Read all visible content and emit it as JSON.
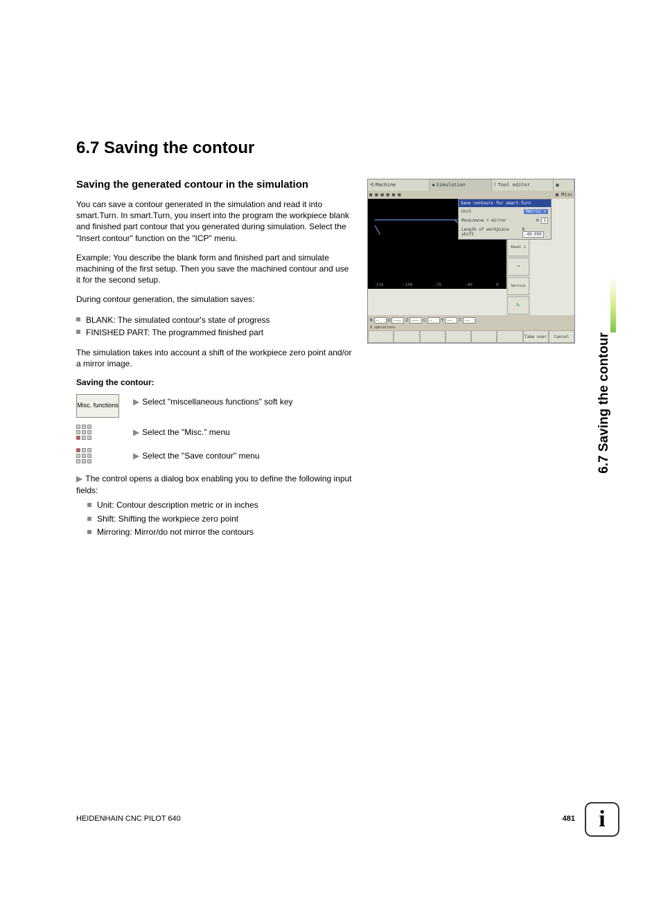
{
  "header": {
    "title": "6.7   Saving the contour",
    "subtitle": "Saving the generated contour in the simulation"
  },
  "paragraphs": {
    "p1": "You can save a contour generated in the simulation and read it into smart.Turn. In smart.Turn, you insert into the program the workpiece blank and finished part contour that you generated during simulation. Select the \"Insert contour\" function on the \"ICP\" menu.",
    "p2": "Example: You describe the blank form and finished part and simulate machining of the first setup. Then you save the machined contour and use it for the second setup.",
    "p3": "During contour generation, the simulation saves:",
    "p4": "The simulation takes into account a shift of the workpiece zero point and/or a mirror image."
  },
  "saves_list": {
    "i1": "BLANK: The simulated contour's state of progress",
    "i2": "FINISHED PART: The programmed finished part"
  },
  "procedure": {
    "title": "Saving the contour:",
    "softkey_label": "Misc. functions",
    "step1": "Select \"miscellaneous functions\" soft key",
    "step2": "Select the \"Misc.\" menu",
    "step3": "Select the \"Save contour\" menu",
    "step4": "The control opens a dialog box enabling you to define the following input fields:",
    "fields": {
      "f1": "Unit: Contour description metric or in inches",
      "f2": "Shift: Shifting the workpiece zero point",
      "f3": "Mirroring: Mirror/do not mirror the contours"
    }
  },
  "screenshot": {
    "tabs": {
      "t1": "Machine",
      "t2": "Simulation",
      "t3": "Tool editor",
      "t4": ""
    },
    "menu_misc": "Misc",
    "dialog": {
      "title": "Save contours for smart.Turn",
      "unit_label": "Unit",
      "unit_value": "Metric",
      "move_label": "Move/move + mirror",
      "move_field": "H",
      "move_value": "1",
      "length_label": "Length of workpiece shift",
      "length_field": "K",
      "length_value": "-48.000"
    },
    "axis": {
      "a1": "-150",
      "a2": "-100",
      "a3": "-70",
      "a4": "-40",
      "a5": "0"
    },
    "status": {
      "n": "N",
      "x": "X",
      "z": "Z",
      "c": "C",
      "y": "Y",
      "t": "T",
      "ops": "0 operations"
    },
    "side": {
      "s1": "",
      "s2": "",
      "s3": "Kanal 1",
      "s4": "",
      "s5": "Service",
      "s6": "T"
    },
    "softkeys": {
      "sk7": "Take over",
      "sk8": "Cancel"
    }
  },
  "side_tab": "6.7 Saving the contour",
  "footer": {
    "left": "HEIDENHAIN CNC PILOT 640",
    "page": "481"
  },
  "info_glyph": "i"
}
